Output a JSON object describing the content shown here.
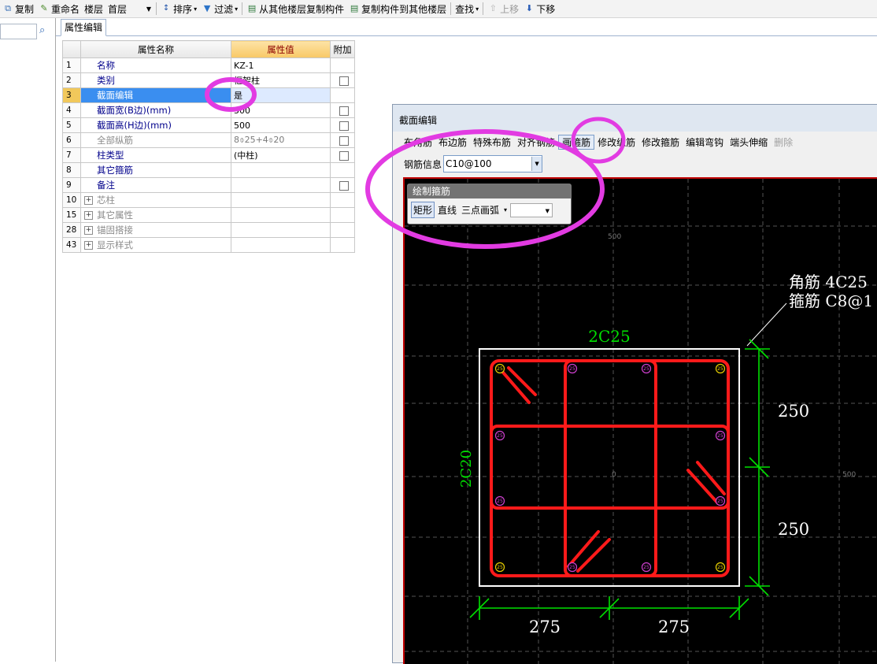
{
  "toolbar": {
    "copy": "复制",
    "rename": "重命名",
    "floor_label": "楼层",
    "floor_value": "首层",
    "sort": "排序",
    "filter": "过滤",
    "copy_from_floor": "从其他楼层复制构件",
    "copy_to_floor": "复制构件到其他楼层",
    "find": "查找",
    "move_up": "上移",
    "move_down": "下移"
  },
  "tab": {
    "label": "属性编辑"
  },
  "grid": {
    "headers": {
      "name": "属性名称",
      "value": "属性值",
      "extra": "附加"
    },
    "rows": [
      {
        "num": "1",
        "name": "名称",
        "value": "KZ-1",
        "check": false
      },
      {
        "num": "2",
        "name": "类别",
        "value": "框架柱",
        "check": true
      },
      {
        "num": "3",
        "name": "截面编辑",
        "value": "是",
        "check": false
      },
      {
        "num": "4",
        "name": "截面宽(B边)(mm)",
        "value": "500",
        "check": true
      },
      {
        "num": "5",
        "name": "截面高(H边)(mm)",
        "value": "500",
        "check": true
      },
      {
        "num": "6",
        "name": "全部纵筋",
        "value": "8⌽25+4⌽20",
        "check": true
      },
      {
        "num": "7",
        "name": "柱类型",
        "value": "(中柱)",
        "check": true
      },
      {
        "num": "8",
        "name": "其它箍筋",
        "value": "",
        "check": false
      },
      {
        "num": "9",
        "name": "备注",
        "value": "",
        "check": true
      },
      {
        "num": "10",
        "name": "芯柱",
        "value": "",
        "check": false
      },
      {
        "num": "15",
        "name": "其它属性",
        "value": "",
        "check": false
      },
      {
        "num": "28",
        "name": "锚固搭接",
        "value": "",
        "check": false
      },
      {
        "num": "43",
        "name": "显示样式",
        "value": "",
        "check": false
      }
    ]
  },
  "section_editor": {
    "title": "截面编辑",
    "toolbar": [
      "布角筋",
      "布边筋",
      "特殊布筋",
      "对齐钢筋",
      "画箍筋",
      "修改纵筋",
      "修改箍筋",
      "编辑弯钩",
      "端头伸缩",
      "删除"
    ],
    "rebar_info_label": "钢筋信息",
    "rebar_info_value": "C10@100"
  },
  "draw_palette": {
    "title": "绘制箍筋",
    "options": [
      "矩形",
      "直线",
      "三点画弧"
    ]
  },
  "canvas": {
    "grid_labels": {
      "top": "500",
      "center": "0",
      "right": "500"
    },
    "top_rebar": "2C25",
    "side_rebar": "2C20",
    "corner_note": "角筋 4C25",
    "stirrup_note": "箍筋 C8@1",
    "dim_right": [
      "250",
      "250"
    ],
    "dim_bottom": [
      "275",
      "275"
    ],
    "bar_label": "25"
  },
  "colors": {
    "stirrup": "#ff1a1a",
    "dimension": "#00e000",
    "annotation": "#e23be2",
    "selection": "#3a8ef0"
  }
}
